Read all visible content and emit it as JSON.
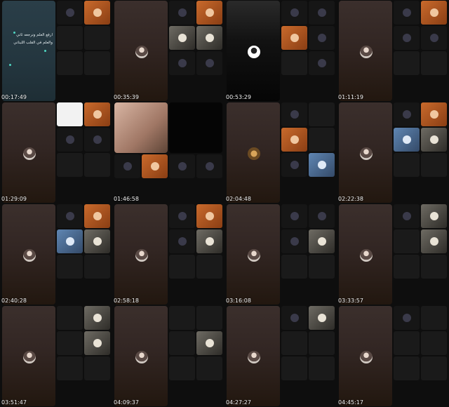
{
  "sheet": {
    "timestamps": [
      "00:17:49",
      "00:35:39",
      "00:53:29",
      "01:11:19",
      "01:29:09",
      "01:46:58",
      "02:04:48",
      "02:22:38",
      "02:40:28",
      "02:58:18",
      "03:16:08",
      "03:33:57",
      "03:51:47",
      "04:09:37",
      "04:27:27",
      "04:45:17"
    ],
    "overlay_text": [
      "ارفع العلم ونرجعه ثاني",
      "والعلم في القلب اللبناني"
    ]
  }
}
